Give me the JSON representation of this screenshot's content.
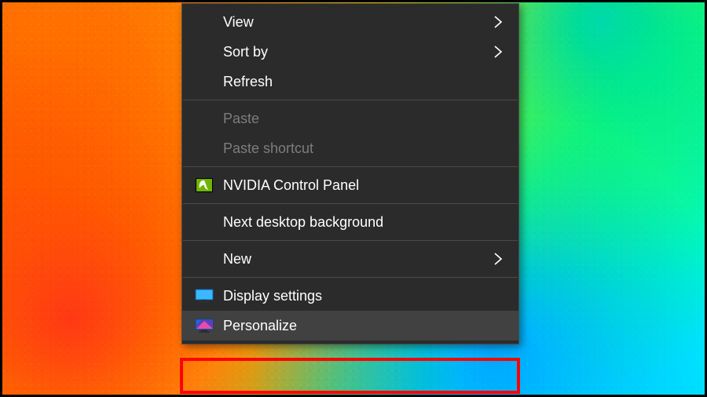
{
  "menu": {
    "items": [
      {
        "label": "View",
        "submenu": true
      },
      {
        "label": "Sort by",
        "submenu": true
      },
      {
        "label": "Refresh"
      },
      {
        "label": "Paste",
        "disabled": true
      },
      {
        "label": "Paste shortcut",
        "disabled": true
      },
      {
        "label": "NVIDIA Control Panel",
        "icon": "nvidia"
      },
      {
        "label": "Next desktop background"
      },
      {
        "label": "New",
        "submenu": true
      },
      {
        "label": "Display settings",
        "icon": "monitor-blue"
      },
      {
        "label": "Personalize",
        "icon": "monitor-purple",
        "hover": true
      }
    ]
  },
  "highlight": {
    "target_index": 9
  }
}
